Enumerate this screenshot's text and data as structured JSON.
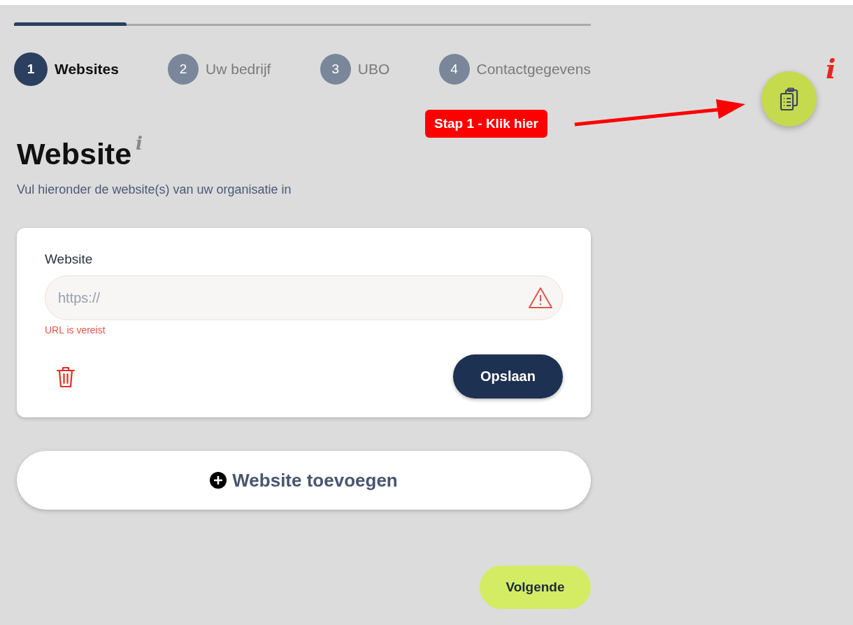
{
  "progress": {
    "level": 0.195
  },
  "steps": [
    {
      "number": "1",
      "label": "Websites",
      "selected": true
    },
    {
      "number": "2",
      "label": "Uw bedrijf",
      "selected": false
    },
    {
      "number": "3",
      "label": "UBO",
      "selected": false
    },
    {
      "number": "4",
      "label": "Contactgegevens",
      "selected": false
    }
  ],
  "info_marker": "i",
  "annotation": {
    "label": "Stap 1 - Klik hier"
  },
  "heading": {
    "title": "Website",
    "info": "i"
  },
  "subtitle": "Vul hieronder de website(s) van uw organisatie in",
  "website_card": {
    "label": "Website",
    "placeholder": "https://",
    "invalid": true,
    "error": "URL is vereist",
    "save_button": "Opslaan"
  },
  "add_button": "Website toevoegen",
  "next_button": "Volgende"
}
